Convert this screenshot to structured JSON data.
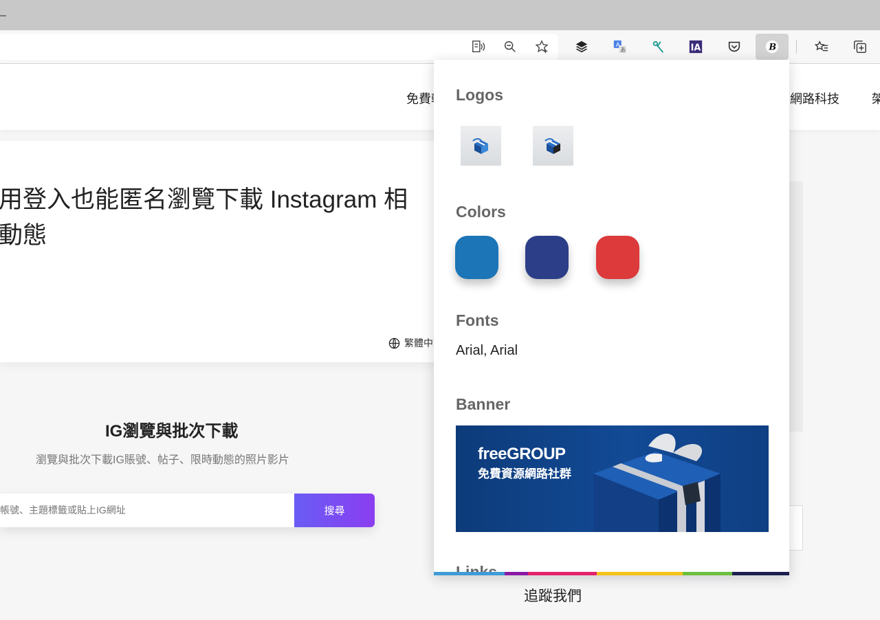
{
  "browser": {
    "title_char": "–",
    "toolbar_icons": [
      "read-aloud-icon",
      "zoom-out-icon",
      "favorite-star-icon",
      "layers-extension-icon",
      "translate-extension-icon",
      "scissors-extension-icon",
      "ia-extension-icon",
      "pocket-extension-icon",
      "brandfetch-extension-icon",
      "favorites-list-icon",
      "collections-icon"
    ]
  },
  "nav": {
    "items": [
      "免費軟",
      "網路科技",
      "架"
    ]
  },
  "hero": {
    "title_line1": "用登入也能匿名瀏覽下載 Instagram 相",
    "title_line2": "動態",
    "lang_label": "繁體中文"
  },
  "ig": {
    "title": "IG瀏覽與批次下載",
    "subtitle": "瀏覽與批次下載IG賬號、帖子、限時動態的照片影片",
    "search_placeholder": "帳號、主題標籤或貼上IG網址",
    "search_button": "搜尋"
  },
  "footer": {
    "follow": "追蹤我們"
  },
  "popup": {
    "logos_heading": "Logos",
    "colors_heading": "Colors",
    "colors": [
      "#1b75b6",
      "#2c3e87",
      "#dc3a3b"
    ],
    "fonts_heading": "Fonts",
    "fonts_value": "Arial, Arial",
    "banner_heading": "Banner",
    "banner_brand": "freeGROUP",
    "banner_tagline": "免費資源網路社群",
    "links_heading": "Links",
    "stripe_colors": [
      "#3e9bd6",
      "#8a1aa6",
      "#e4206a",
      "#f4c21a",
      "#6cbf3c",
      "#1d1f4f"
    ]
  }
}
